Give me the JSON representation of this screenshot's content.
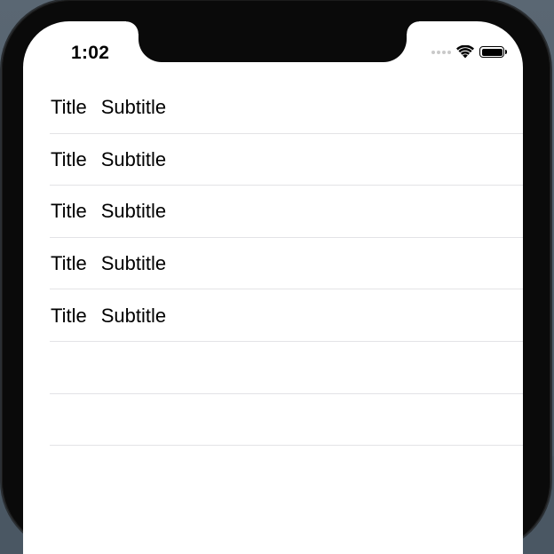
{
  "status_bar": {
    "time": "1:02",
    "icons": [
      "cellular-signal-icon",
      "wifi-icon",
      "battery-icon"
    ]
  },
  "table": {
    "rows": [
      {
        "title": "Title",
        "subtitle": "Subtitle"
      },
      {
        "title": "Title",
        "subtitle": "Subtitle"
      },
      {
        "title": "Title",
        "subtitle": "Subtitle"
      },
      {
        "title": "Title",
        "subtitle": "Subtitle"
      },
      {
        "title": "Title",
        "subtitle": "Subtitle"
      },
      {
        "title": "",
        "subtitle": ""
      },
      {
        "title": "",
        "subtitle": ""
      }
    ]
  },
  "colors": {
    "background": "#ffffff",
    "separator": "#e3e3e6",
    "text": "#000000",
    "bezel": "#0a0a0a"
  }
}
